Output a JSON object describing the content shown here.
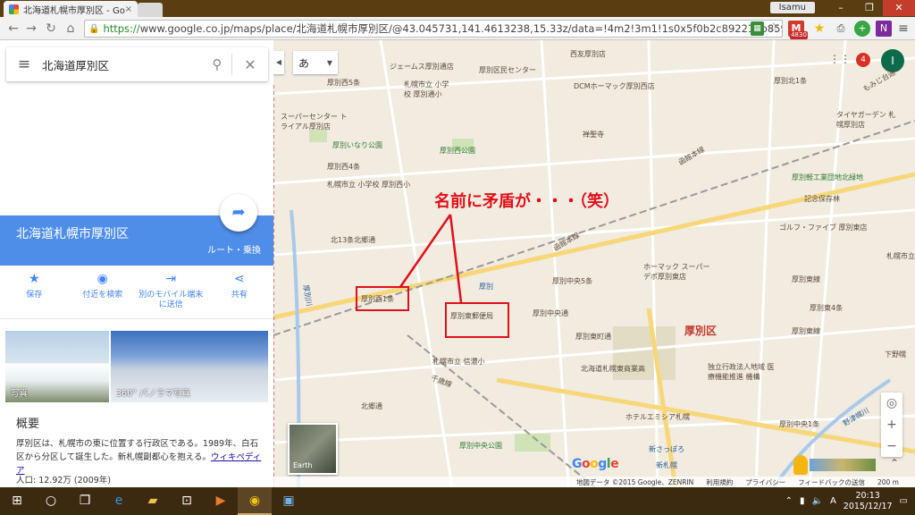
{
  "browser": {
    "tab_title": "北海道札幌市厚別区 - Goo",
    "tab_close": "×",
    "user_label": "Isamu",
    "url_https": "https://",
    "url_rest": "www.google.co.jp/maps/place/北海道札幌市厚別区/@43.045731,141.4613238,15.33z/data=!4m2!3m1!1s0x5f0b2c892213b859:0xb4",
    "badge_count": "4830"
  },
  "panel": {
    "search_query": "北海道厚別区",
    "place_name": "北海道札幌市厚別区",
    "route_label": "ルート・乗換",
    "actions": [
      {
        "label": "保存",
        "icon": "star-icon"
      },
      {
        "label": "付近を検索",
        "icon": "pin-icon"
      },
      {
        "label": "別のモバイル端末に送信",
        "icon": "send-to-device-icon"
      },
      {
        "label": "共有",
        "icon": "share-icon"
      }
    ],
    "photo1_label": "写真",
    "photo2_label": "360° パノラマ写真",
    "summary_heading": "概要",
    "summary_text": "厚別区は、札幌市の東に位置する行政区である。1989年、白石区から分区して誕生した。新札幌副都心を抱える。",
    "summary_link": "ウィキペディア",
    "population": "人口: 12.92万 (2009年)"
  },
  "map": {
    "ime_label": "あ",
    "notification_count": "4",
    "avatar_letter": "I",
    "earth_label": "Earth",
    "google_logo": "Google",
    "annotation": "名前に矛盾が・・・（笑）",
    "boxed_labels": [
      "厚別西1条",
      "厚別東郵便局"
    ],
    "district_label": "厚別区",
    "labels": [
      "ジェームス厚別通店",
      "厚別西5条",
      "札幌市立 小学校 厚別通小",
      "厚別区民センター",
      "西友厚別店",
      "DCMホーマック厚別西店",
      "スーパーセンター トライアル厚別店",
      "厚別北1条",
      "タイヤガーデン 札幌厚別店",
      "厚別いなり公園",
      "厚別西公園",
      "禅聖寺",
      "厚別西4条",
      "函館本線",
      "札幌市立 小学校 厚別西小",
      "厚別軽工業団地北緑地",
      "記念保存林",
      "北13条北郷通",
      "ゴルフ・ファイブ 厚別東店",
      "函館本線",
      "厚別",
      "ホーマック スーパーデポ厚別東店",
      "厚別中央5条",
      "厚別東線",
      "厚別東町通",
      "厚別東4条",
      "厚別東線",
      "厚別東郵便局",
      "厚別中央通",
      "札幌市立 信濃小",
      "北海道札幌東商業高",
      "独立行政法人地域 医療機能推進 機構",
      "千歳線",
      "ホテルエミシア札幌",
      "厚別中央1条",
      "厚別中央公園",
      "新さっぽろ",
      "新札幌",
      "野幌",
      "札幌市立 小学校 小野幌小",
      "下野幌",
      "北郷通",
      "厚別川",
      "野津幌川",
      "もみじ台通"
    ],
    "footer": [
      "地図データ ©2015 Google、ZENRIN",
      "利用規約",
      "プライバシー",
      "フィードバックの送信",
      "200 m"
    ]
  },
  "taskbar": {
    "time": "20:13",
    "date": "2015/12/17"
  }
}
